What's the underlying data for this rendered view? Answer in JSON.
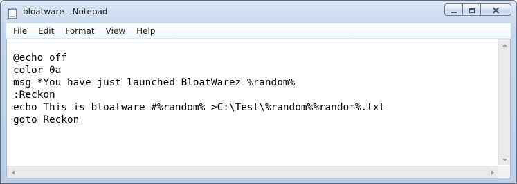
{
  "window": {
    "title": "bloatware - Notepad",
    "app_icon": "notepad-icon",
    "caption_buttons": [
      "minimize-icon",
      "maximize-icon",
      "close-icon"
    ]
  },
  "menu": {
    "file": "File",
    "edit": "Edit",
    "format": "Format",
    "view": "View",
    "help": "Help"
  },
  "document": {
    "lines": [
      "@echo off",
      "color 0a",
      "msg *You have just launched BloatWarez %random%",
      ":Reckon",
      "echo This is bloatware #%random% >C:\\Test\\%random%%random%.txt",
      "goto Reckon"
    ]
  },
  "colors": {
    "title_text": "#1a1a1a",
    "frame": "#c4d7ee",
    "close_glyph": "#3c4f68"
  }
}
